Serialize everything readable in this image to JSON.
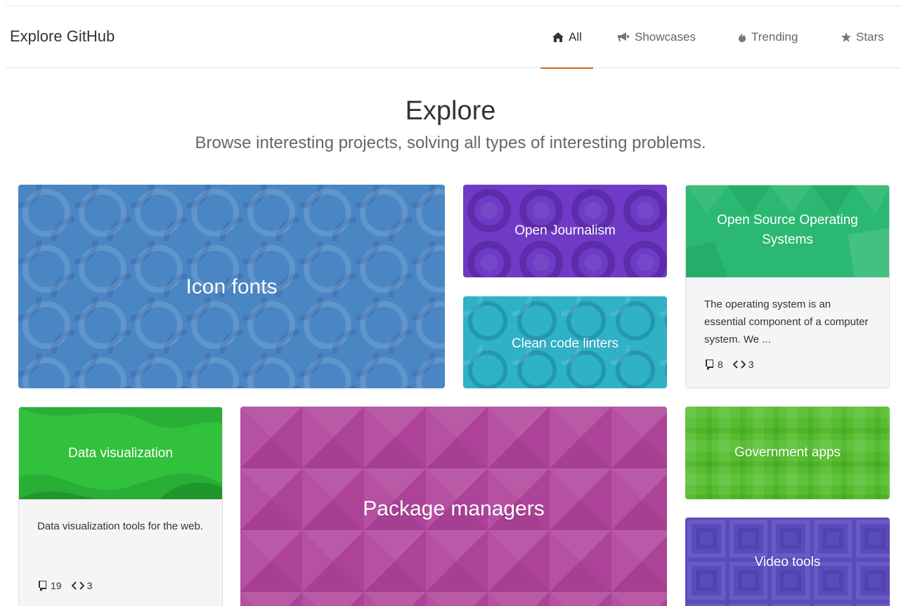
{
  "header": {
    "title": "Explore GitHub",
    "nav": [
      {
        "label": "All",
        "icon": "home-icon",
        "selected": true
      },
      {
        "label": "Showcases",
        "icon": "megaphone-icon",
        "selected": false
      },
      {
        "label": "Trending",
        "icon": "flame-icon",
        "selected": false
      },
      {
        "label": "Stars",
        "icon": "star-icon",
        "selected": false
      }
    ]
  },
  "hero": {
    "title": "Explore",
    "subtitle": "Browse interesting projects, solving all types of interesting problems."
  },
  "tiles": {
    "icon_fonts": {
      "label": "Icon fonts",
      "color": "#4a86c4"
    },
    "open_journalism": {
      "label": "Open Journalism",
      "color": "#6f3bc6"
    },
    "clean_code_linters": {
      "label": "Clean code linters",
      "color": "#2fb1c6"
    },
    "os": {
      "label": "Open Source Operating Systems",
      "color": "#2bb872",
      "description": "The operating system is an essential component of a computer system. We ...",
      "repos": "8",
      "languages": "3"
    },
    "data_viz": {
      "label": "Data visualization",
      "color": "#32c13d",
      "description": "Data visualization tools for the web.",
      "repos": "19",
      "languages": "3"
    },
    "package_managers": {
      "label": "Package managers",
      "color": "#b1479d"
    },
    "government_apps": {
      "label": "Government apps",
      "color": "#55bd2e"
    },
    "video_tools": {
      "label": "Video tools",
      "color": "#5a4bbd"
    }
  }
}
